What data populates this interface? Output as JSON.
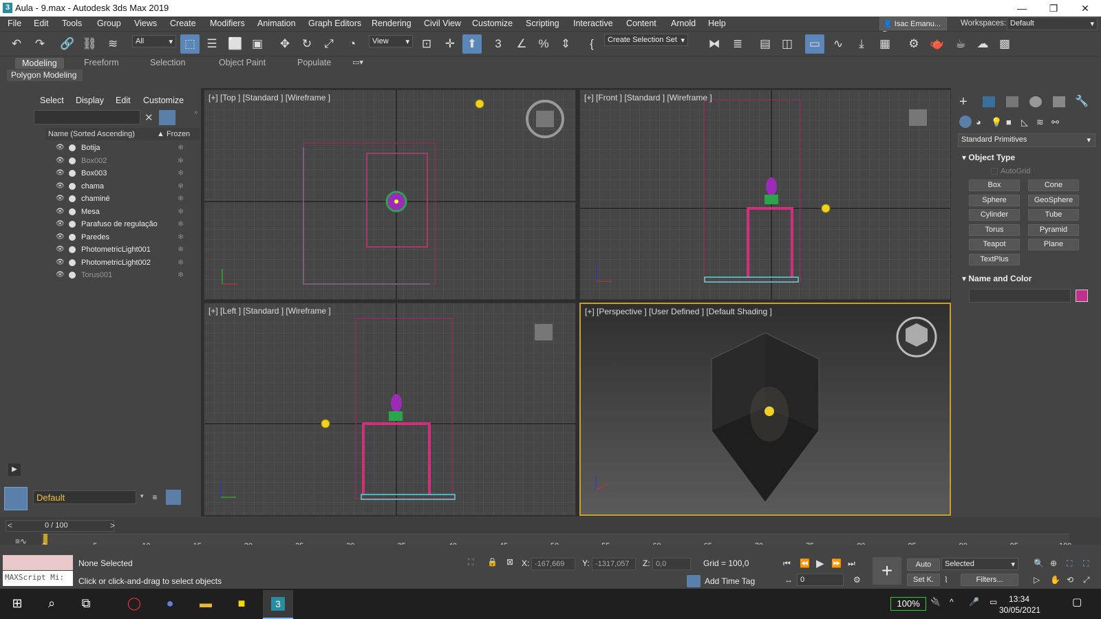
{
  "window": {
    "title": "Aula - 9.max - Autodesk 3ds Max 2019",
    "minimize": "—",
    "maximize": "❐",
    "close": "✕"
  },
  "menu": [
    "File",
    "Edit",
    "Tools",
    "Group",
    "Views",
    "Create",
    "Modifiers",
    "Animation",
    "Graph Editors",
    "Rendering",
    "Civil View",
    "Customize",
    "Scripting",
    "Interactive",
    "Content",
    "Arnold",
    "Help"
  ],
  "user": "Isac Emanu...",
  "workspace": {
    "label": "Workspaces:",
    "value": "Default"
  },
  "toolbar": {
    "filter": "All",
    "refcoord": "View",
    "selection_set": "Create Selection Set"
  },
  "ribbon": {
    "tabs": [
      "Modeling",
      "Freeform",
      "Selection",
      "Object Paint",
      "Populate"
    ],
    "sub": "Polygon Modeling"
  },
  "explorer": {
    "menu": [
      "Select",
      "Display",
      "Edit",
      "Customize"
    ],
    "header_name": "Name (Sorted Ascending)",
    "header_frozen": "▲ Frozen",
    "items": [
      {
        "name": "Botija",
        "dim": false
      },
      {
        "name": "Box002",
        "dim": true
      },
      {
        "name": "Box003",
        "dim": false
      },
      {
        "name": "chama",
        "dim": false
      },
      {
        "name": "chaminé",
        "dim": false
      },
      {
        "name": "Mesa",
        "dim": false
      },
      {
        "name": "Parafuso de regulação",
        "dim": false
      },
      {
        "name": "Paredes",
        "dim": false
      },
      {
        "name": "PhotometricLight001",
        "dim": false
      },
      {
        "name": "PhotometricLight002",
        "dim": false
      },
      {
        "name": "Torus001",
        "dim": true
      }
    ],
    "layer": "Default"
  },
  "viewports": {
    "top": "[+] [Top ] [Standard ] [Wireframe ]",
    "front": "[+] [Front ] [Standard ] [Wireframe ]",
    "left": "[+] [Left ] [Standard ] [Wireframe ]",
    "persp": "[+] [Perspective ] [User Defined ] [Default Shading ]"
  },
  "command_panel": {
    "category": "Standard Primitives",
    "object_type": "Object Type",
    "autogrid": "AutoGrid",
    "buttons": [
      "Box",
      "Cone",
      "Sphere",
      "GeoSphere",
      "Cylinder",
      "Tube",
      "Torus",
      "Pyramid",
      "Teapot",
      "Plane",
      "TextPlus"
    ],
    "name_color": "Name and Color",
    "swatch": "#c0308a"
  },
  "timeline": {
    "frame": "0 / 100",
    "ticks": [
      "0",
      "5",
      "10",
      "15",
      "20",
      "25",
      "30",
      "35",
      "40",
      "45",
      "50",
      "55",
      "60",
      "65",
      "70",
      "75",
      "80",
      "85",
      "90",
      "95",
      "100"
    ]
  },
  "status": {
    "maxscript": "MAXScript Mi:",
    "selected": "None Selected",
    "prompt": "Click or click-and-drag to select objects",
    "x_label": "X:",
    "x": "-167,669",
    "y_label": "Y:",
    "y": "-1317,057",
    "z_label": "Z:",
    "z": "0,0",
    "grid": "Grid = 100,0",
    "add_time_tag": "Add Time Tag",
    "auto": "Auto",
    "setk": "Set K.",
    "key_mode": "Selected",
    "filters": "Filters...",
    "frame_field": "0"
  },
  "taskbar": {
    "battery": "100%",
    "time": "13:34",
    "date": "30/05/2021"
  }
}
